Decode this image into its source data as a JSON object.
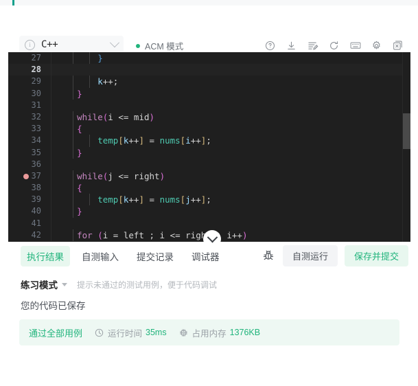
{
  "toolbar": {
    "language": "C++",
    "info_icon": "info-circle-icon",
    "chevron_icon": "chevron-down-icon",
    "acm_mode": "ACM 模式",
    "acm_dot_color": "#21b47c",
    "icons": [
      {
        "name": "help-icon",
        "label": "帮助"
      },
      {
        "name": "download-icon",
        "label": "下载代码"
      },
      {
        "name": "format-code-icon",
        "label": "格式化代码"
      },
      {
        "name": "reset-icon",
        "label": "重置代码"
      },
      {
        "name": "keyboard-icon",
        "label": "快捷键"
      },
      {
        "name": "settings-icon",
        "label": "设置"
      },
      {
        "name": "close-panel-icon",
        "label": "关闭面板"
      }
    ]
  },
  "editor": {
    "current_line": 28,
    "breakpoint_line": 37,
    "theme_bg": "#1f1f1f",
    "lines": [
      {
        "n": 27,
        "tokens": [
          {
            "t": "        ",
            "c": "o"
          },
          {
            "t": "}",
            "c": "b"
          }
        ]
      },
      {
        "n": 28,
        "tokens": []
      },
      {
        "n": 29,
        "tokens": [
          {
            "t": "        ",
            "c": "o"
          },
          {
            "t": "k",
            "c": "v"
          },
          {
            "t": "++;",
            "c": "o"
          }
        ]
      },
      {
        "n": 30,
        "tokens": [
          {
            "t": "    ",
            "c": "o"
          },
          {
            "t": "}",
            "c": "p"
          }
        ]
      },
      {
        "n": 31,
        "tokens": []
      },
      {
        "n": 32,
        "tokens": [
          {
            "t": "    ",
            "c": "o"
          },
          {
            "t": "while",
            "c": "k"
          },
          {
            "t": "(",
            "c": "p"
          },
          {
            "t": "i ",
            "c": "o"
          },
          {
            "t": "<= ",
            "c": "o"
          },
          {
            "t": "mid",
            "c": "o"
          },
          {
            "t": ")",
            "c": "p"
          }
        ]
      },
      {
        "n": 33,
        "tokens": [
          {
            "t": "    ",
            "c": "o"
          },
          {
            "t": "{",
            "c": "p"
          }
        ]
      },
      {
        "n": 34,
        "tokens": [
          {
            "t": "        ",
            "c": "o"
          },
          {
            "t": "temp",
            "c": "f"
          },
          {
            "t": "[",
            "c": "y"
          },
          {
            "t": "k",
            "c": "v"
          },
          {
            "t": "++",
            "c": "o"
          },
          {
            "t": "]",
            "c": "y"
          },
          {
            "t": " = ",
            "c": "o"
          },
          {
            "t": "nums",
            "c": "f"
          },
          {
            "t": "[",
            "c": "y"
          },
          {
            "t": "i",
            "c": "v"
          },
          {
            "t": "++",
            "c": "o"
          },
          {
            "t": "]",
            "c": "y"
          },
          {
            "t": ";",
            "c": "o"
          }
        ]
      },
      {
        "n": 35,
        "tokens": [
          {
            "t": "    ",
            "c": "o"
          },
          {
            "t": "}",
            "c": "p"
          }
        ]
      },
      {
        "n": 36,
        "tokens": []
      },
      {
        "n": 37,
        "tokens": [
          {
            "t": "    ",
            "c": "o"
          },
          {
            "t": "while",
            "c": "k"
          },
          {
            "t": "(",
            "c": "p"
          },
          {
            "t": "j ",
            "c": "o"
          },
          {
            "t": "<= ",
            "c": "o"
          },
          {
            "t": "right",
            "c": "o"
          },
          {
            "t": ")",
            "c": "p"
          }
        ]
      },
      {
        "n": 38,
        "tokens": [
          {
            "t": "    ",
            "c": "o"
          },
          {
            "t": "{",
            "c": "p"
          }
        ]
      },
      {
        "n": 39,
        "tokens": [
          {
            "t": "        ",
            "c": "o"
          },
          {
            "t": "temp",
            "c": "f"
          },
          {
            "t": "[",
            "c": "y"
          },
          {
            "t": "k",
            "c": "v"
          },
          {
            "t": "++",
            "c": "o"
          },
          {
            "t": "]",
            "c": "y"
          },
          {
            "t": " = ",
            "c": "o"
          },
          {
            "t": "nums",
            "c": "f"
          },
          {
            "t": "[",
            "c": "y"
          },
          {
            "t": "j",
            "c": "v"
          },
          {
            "t": "++",
            "c": "o"
          },
          {
            "t": "]",
            "c": "y"
          },
          {
            "t": ";",
            "c": "o"
          }
        ]
      },
      {
        "n": 40,
        "tokens": [
          {
            "t": "    ",
            "c": "o"
          },
          {
            "t": "}",
            "c": "p"
          }
        ]
      },
      {
        "n": 41,
        "tokens": []
      },
      {
        "n": 42,
        "tokens": [
          {
            "t": "    ",
            "c": "o"
          },
          {
            "t": "for",
            "c": "k"
          },
          {
            "t": " ",
            "c": "o"
          },
          {
            "t": "(",
            "c": "p"
          },
          {
            "t": "i = left ; i <= right ; i++",
            "c": "o"
          },
          {
            "t": ")",
            "c": "p"
          }
        ]
      }
    ]
  },
  "collapse_button": {
    "icon": "chevron-down-icon"
  },
  "bottom": {
    "tabs": [
      {
        "label": "执行结果",
        "active": true
      },
      {
        "label": "自测输入",
        "active": false
      },
      {
        "label": "提交记录",
        "active": false
      },
      {
        "label": "调试器",
        "active": false
      }
    ],
    "debug_icon": "bug-icon",
    "run_button": "自测运行",
    "submit_button": "保存并提交",
    "mode_label": "练习模式",
    "mode_hint": "提示未通过的测试用例，便于代码调试",
    "saved_text": "您的代码已保存",
    "result": {
      "status": "通过全部用例",
      "status_color": "#21b47c",
      "runtime_label": "运行时间",
      "runtime_value": "35ms",
      "memory_label": "占用内存",
      "memory_value": "1376KB",
      "clock_icon": "clock-icon",
      "chip_icon": "chip-icon"
    }
  }
}
